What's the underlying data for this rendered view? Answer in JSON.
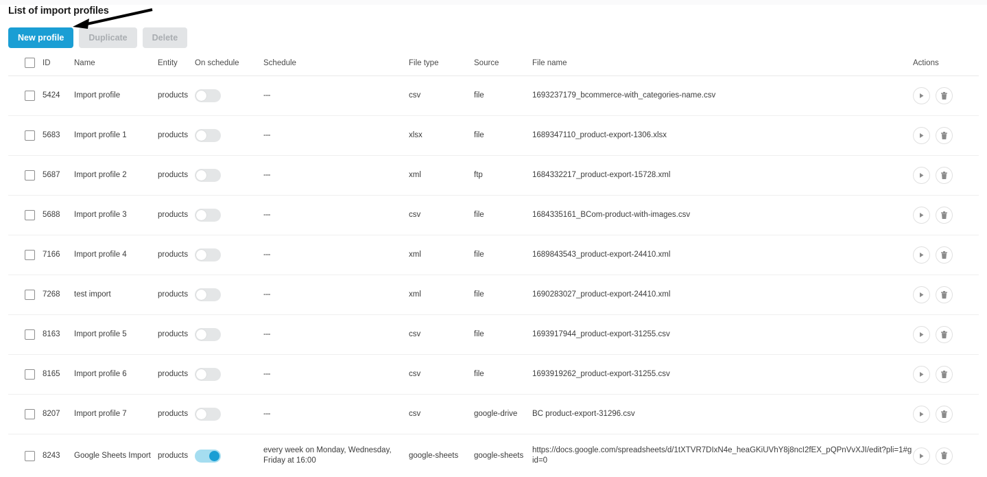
{
  "page": {
    "title": "List of import profiles"
  },
  "toolbar": {
    "new_profile_label": "New profile",
    "duplicate_label": "Duplicate",
    "delete_label": "Delete",
    "accent_color": "#1a9ed4",
    "disabled_color": "#e2e4e6"
  },
  "annotation": {
    "type": "arrow",
    "points_to": "New profile"
  },
  "table": {
    "columns": [
      {
        "key": "checkbox",
        "label": ""
      },
      {
        "key": "id",
        "label": "ID"
      },
      {
        "key": "name",
        "label": "Name"
      },
      {
        "key": "entity",
        "label": "Entity"
      },
      {
        "key": "on_schedule",
        "label": "On schedule"
      },
      {
        "key": "schedule",
        "label": "Schedule"
      },
      {
        "key": "file_type",
        "label": "File type"
      },
      {
        "key": "source",
        "label": "Source"
      },
      {
        "key": "file_name",
        "label": "File name"
      },
      {
        "key": "actions",
        "label": "Actions"
      }
    ],
    "rows": [
      {
        "id": "5424",
        "name": "Import profile",
        "entity": "products",
        "on_schedule": false,
        "schedule": "---",
        "file_type": "csv",
        "source": "file",
        "file_name": "1693237179_bcommerce-with_categories-name.csv"
      },
      {
        "id": "5683",
        "name": "Import profile 1",
        "entity": "products",
        "on_schedule": false,
        "schedule": "---",
        "file_type": "xlsx",
        "source": "file",
        "file_name": "1689347110_product-export-1306.xlsx"
      },
      {
        "id": "5687",
        "name": "Import profile 2",
        "entity": "products",
        "on_schedule": false,
        "schedule": "---",
        "file_type": "xml",
        "source": "ftp",
        "file_name": "1684332217_product-export-15728.xml"
      },
      {
        "id": "5688",
        "name": "Import profile 3",
        "entity": "products",
        "on_schedule": false,
        "schedule": "---",
        "file_type": "csv",
        "source": "file",
        "file_name": "1684335161_BCom-product-with-images.csv"
      },
      {
        "id": "7166",
        "name": "Import profile 4",
        "entity": "products",
        "on_schedule": false,
        "schedule": "---",
        "file_type": "xml",
        "source": "file",
        "file_name": "1689843543_product-export-24410.xml"
      },
      {
        "id": "7268",
        "name": "test import",
        "entity": "products",
        "on_schedule": false,
        "schedule": "---",
        "file_type": "xml",
        "source": "file",
        "file_name": "1690283027_product-export-24410.xml"
      },
      {
        "id": "8163",
        "name": "Import profile 5",
        "entity": "products",
        "on_schedule": false,
        "schedule": "---",
        "file_type": "csv",
        "source": "file",
        "file_name": "1693917944_product-export-31255.csv"
      },
      {
        "id": "8165",
        "name": "Import profile 6",
        "entity": "products",
        "on_schedule": false,
        "schedule": "---",
        "file_type": "csv",
        "source": "file",
        "file_name": "1693919262_product-export-31255.csv"
      },
      {
        "id": "8207",
        "name": "Import profile 7",
        "entity": "products",
        "on_schedule": false,
        "schedule": "---",
        "file_type": "csv",
        "source": "google-drive",
        "file_name": "BC product-export-31296.csv"
      },
      {
        "id": "8243",
        "name": "Google Sheets Import",
        "entity": "products",
        "on_schedule": true,
        "schedule": "every week on Monday, Wednesday, Friday at 16:00",
        "file_type": "google-sheets",
        "source": "google-sheets",
        "file_name": "https://docs.google.com/spreadsheets/d/1tXTVR7DIxN4e_heaGKiUVhY8j8ncI2fEX_pQPnVvXJI/edit?pli=1#gid=0"
      }
    ],
    "row_actions": [
      {
        "key": "run",
        "icon": "play-icon"
      },
      {
        "key": "delete",
        "icon": "trash-icon"
      }
    ]
  }
}
